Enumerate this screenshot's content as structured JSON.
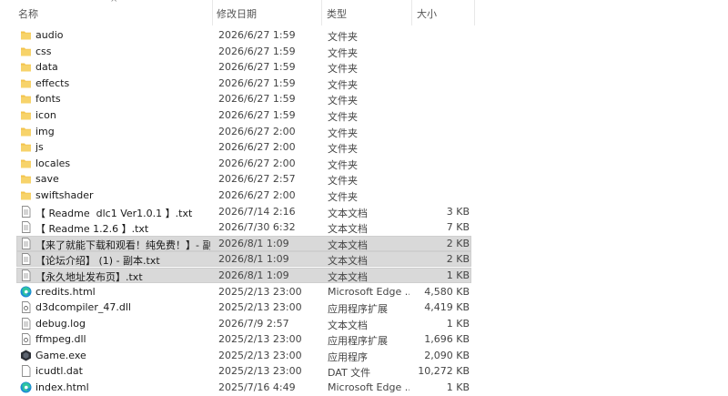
{
  "columns": {
    "name": "名称",
    "date": "修改日期",
    "type": "类型",
    "size": "大小"
  },
  "rows": [
    {
      "name": "audio",
      "date": "2026/6/27 1:59",
      "type": "文件夹",
      "size": "",
      "icon": "folder-icon",
      "selected": false
    },
    {
      "name": "css",
      "date": "2026/6/27 1:59",
      "type": "文件夹",
      "size": "",
      "icon": "folder-icon",
      "selected": false
    },
    {
      "name": "data",
      "date": "2026/6/27 1:59",
      "type": "文件夹",
      "size": "",
      "icon": "folder-icon",
      "selected": false
    },
    {
      "name": "effects",
      "date": "2026/6/27 1:59",
      "type": "文件夹",
      "size": "",
      "icon": "folder-icon",
      "selected": false
    },
    {
      "name": "fonts",
      "date": "2026/6/27 1:59",
      "type": "文件夹",
      "size": "",
      "icon": "folder-icon",
      "selected": false
    },
    {
      "name": "icon",
      "date": "2026/6/27 1:59",
      "type": "文件夹",
      "size": "",
      "icon": "folder-icon",
      "selected": false
    },
    {
      "name": "img",
      "date": "2026/6/27 2:00",
      "type": "文件夹",
      "size": "",
      "icon": "folder-icon",
      "selected": false
    },
    {
      "name": "js",
      "date": "2026/6/27 2:00",
      "type": "文件夹",
      "size": "",
      "icon": "folder-icon",
      "selected": false
    },
    {
      "name": "locales",
      "date": "2026/6/27 2:00",
      "type": "文件夹",
      "size": "",
      "icon": "folder-icon",
      "selected": false
    },
    {
      "name": "save",
      "date": "2026/6/27 2:57",
      "type": "文件夹",
      "size": "",
      "icon": "folder-icon",
      "selected": false
    },
    {
      "name": "swiftshader",
      "date": "2026/6/27 2:00",
      "type": "文件夹",
      "size": "",
      "icon": "folder-icon",
      "selected": false
    },
    {
      "name": "【 Readme  dlc1 Ver1.0.1 】.txt",
      "date": "2026/7/14 2:16",
      "type": "文本文档",
      "size": "3 KB",
      "icon": "text-file-icon",
      "selected": false
    },
    {
      "name": "【 Readme 1.2.6 】.txt",
      "date": "2026/7/30 6:32",
      "type": "文本文档",
      "size": "7 KB",
      "icon": "text-file-icon",
      "selected": false
    },
    {
      "name": "【来了就能下载和观看！纯免费！】- 副...",
      "date": "2026/8/1 1:09",
      "type": "文本文档",
      "size": "2 KB",
      "icon": "text-file-icon",
      "selected": true
    },
    {
      "name": "【论坛介绍】 (1) - 副本.txt",
      "date": "2026/8/1 1:09",
      "type": "文本文档",
      "size": "2 KB",
      "icon": "text-file-icon",
      "selected": true
    },
    {
      "name": "【永久地址发布页】.txt",
      "date": "2026/8/1 1:09",
      "type": "文本文档",
      "size": "1 KB",
      "icon": "text-file-icon",
      "selected": true
    },
    {
      "name": "credits.html",
      "date": "2025/2/13 23:00",
      "type": "Microsoft Edge ...",
      "size": "4,580 KB",
      "icon": "edge-icon",
      "selected": false
    },
    {
      "name": "d3dcompiler_47.dll",
      "date": "2025/2/13 23:00",
      "type": "应用程序扩展",
      "size": "4,419 KB",
      "icon": "dll-file-icon",
      "selected": false
    },
    {
      "name": "debug.log",
      "date": "2026/7/9 2:57",
      "type": "文本文档",
      "size": "1 KB",
      "icon": "text-file-icon",
      "selected": false
    },
    {
      "name": "ffmpeg.dll",
      "date": "2025/2/13 23:00",
      "type": "应用程序扩展",
      "size": "1,696 KB",
      "icon": "dll-file-icon",
      "selected": false
    },
    {
      "name": "Game.exe",
      "date": "2025/2/13 23:00",
      "type": "应用程序",
      "size": "2,090 KB",
      "icon": "game-exe-icon",
      "selected": false
    },
    {
      "name": "icudtl.dat",
      "date": "2025/2/13 23:00",
      "type": "DAT 文件",
      "size": "10,272 KB",
      "icon": "blank-file-icon",
      "selected": false
    },
    {
      "name": "index.html",
      "date": "2025/7/16 4:49",
      "type": "Microsoft Edge ...",
      "size": "1 KB",
      "icon": "edge-icon",
      "selected": false
    }
  ],
  "colors": {
    "folder": "#f3c34c",
    "selection": "#d9d9d9",
    "edge_a": "#1c8bd6",
    "edge_b": "#2ec4a0"
  }
}
